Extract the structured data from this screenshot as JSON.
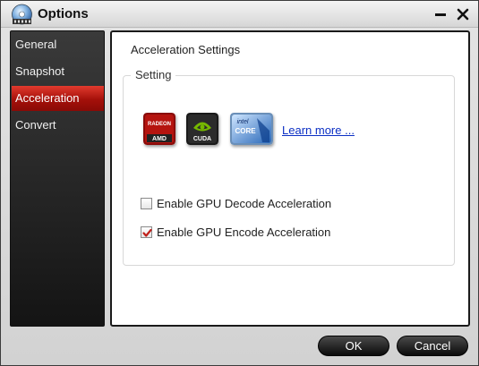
{
  "window": {
    "title": "Options"
  },
  "sidebar": {
    "items": [
      {
        "label": "General",
        "active": false
      },
      {
        "label": "Snapshot",
        "active": false
      },
      {
        "label": "Acceleration",
        "active": true
      },
      {
        "label": "Convert",
        "active": false
      }
    ]
  },
  "content": {
    "title": "Acceleration Settings",
    "group_legend": "Setting",
    "logos": [
      {
        "name": "amd-logo",
        "text": "AMD",
        "small_text": "RADEON"
      },
      {
        "name": "nvidia-cuda-logo",
        "text": "CUDA"
      },
      {
        "name": "intel-core-logo",
        "text": "CORE",
        "small_text": "intel"
      }
    ],
    "learn_more": "Learn more ...",
    "options": [
      {
        "label": "Enable GPU Decode Acceleration",
        "checked": false
      },
      {
        "label": "Enable GPU Encode Acceleration",
        "checked": true
      }
    ]
  },
  "buttons": {
    "ok": "OK",
    "cancel": "Cancel"
  },
  "colors": {
    "accent": "#b3150e",
    "link": "#0b2fc4",
    "check": "#c0201a"
  }
}
